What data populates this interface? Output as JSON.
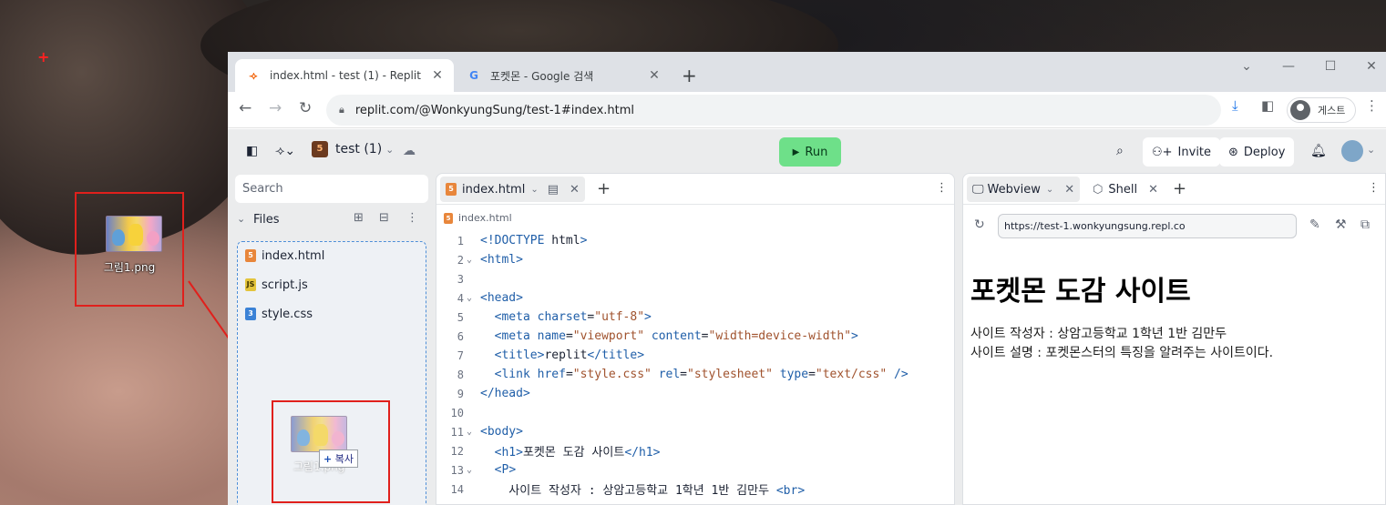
{
  "desktop": {
    "icon_label": "그림1.png"
  },
  "browser": {
    "tabs": [
      {
        "title": "index.html - test (1) - Replit",
        "active": true
      },
      {
        "title": "포켓몬 - Google 검색",
        "active": false
      }
    ],
    "new_tab": "+",
    "url": "replit.com/@WonkyungSung/test-1#index.html",
    "profile_label": "게스트"
  },
  "replit": {
    "repl_name": "test (1)",
    "run_label": "Run",
    "invite_label": "Invite",
    "deploy_label": "Deploy",
    "sidebar": {
      "search_placeholder": "Search",
      "files_label": "Files",
      "files": [
        {
          "name": "index.html",
          "type": "html"
        },
        {
          "name": "script.js",
          "type": "js"
        },
        {
          "name": "style.css",
          "type": "css"
        }
      ],
      "drag_ghost_label": "그림1.png",
      "drag_tooltip": "복사"
    },
    "editor": {
      "tab_label": "index.html",
      "breadcrumb": "index.html",
      "lines": [
        {
          "n": "1",
          "fold": "",
          "text": "<!DOCTYPE html>"
        },
        {
          "n": "2",
          "fold": "⌄",
          "text": "<html>"
        },
        {
          "n": "3",
          "fold": "",
          "text": ""
        },
        {
          "n": "4",
          "fold": "⌄",
          "text": "<head>"
        },
        {
          "n": "5",
          "fold": "",
          "text": "  <meta charset=\"utf-8\">"
        },
        {
          "n": "6",
          "fold": "",
          "text": "  <meta name=\"viewport\" content=\"width=device-width\">"
        },
        {
          "n": "7",
          "fold": "",
          "text": "  <title>replit</title>"
        },
        {
          "n": "8",
          "fold": "",
          "text": "  <link href=\"style.css\" rel=\"stylesheet\" type=\"text/css\" />"
        },
        {
          "n": "9",
          "fold": "",
          "text": "</head>"
        },
        {
          "n": "10",
          "fold": "",
          "text": ""
        },
        {
          "n": "11",
          "fold": "⌄",
          "text": "<body>"
        },
        {
          "n": "12",
          "fold": "",
          "text": "  <h1>포켓몬 도감 사이트</h1>"
        },
        {
          "n": "13",
          "fold": "⌄",
          "text": "  <P>"
        },
        {
          "n": "14",
          "fold": "",
          "text": "    사이트 작성자 : 상암고등학교 1학년 1반 김만두 <br>"
        }
      ]
    },
    "webview": {
      "tab_label": "Webview",
      "shell_label": "Shell",
      "url": "https://test-1.wonkyungsung.repl.co",
      "heading": "포켓몬 도감 사이트",
      "paragraph_lines": [
        "사이트 작성자 : 상암고등학교 1학년 1반 김만두",
        "사이트 설명 : 포켓몬스터의 특징을 알려주는 사이트이다."
      ]
    }
  },
  "colors": {
    "run_button": "#6ee089",
    "highlight_box": "#e0201c",
    "drop_zone_border": "#4e8fd8"
  }
}
